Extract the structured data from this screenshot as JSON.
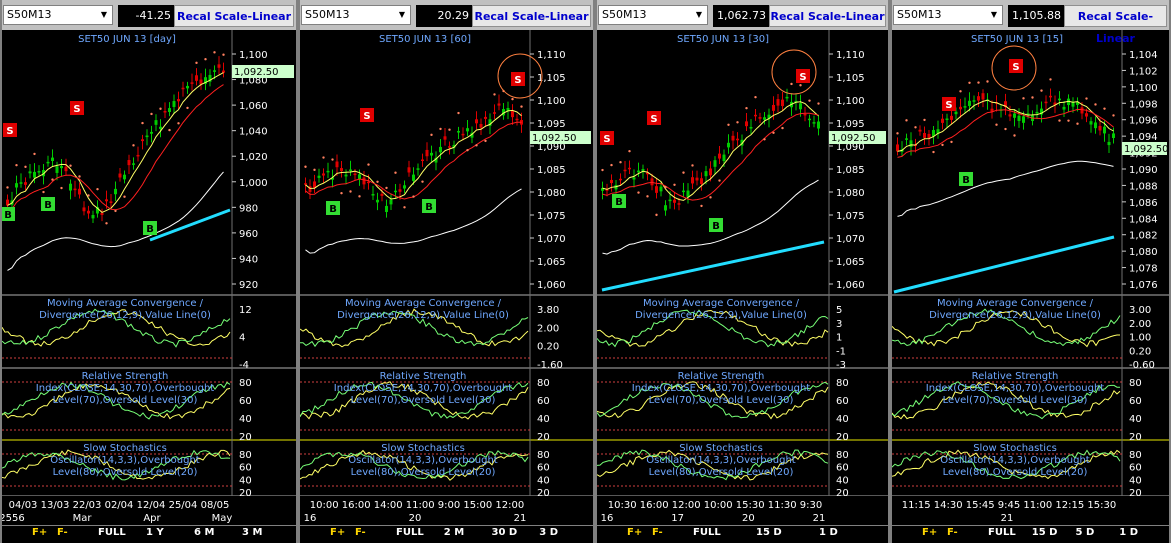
{
  "panels": [
    {
      "symbol": "S50M13",
      "value": "-41.25",
      "recal": "Recal Scale-Linear",
      "title": "SET50 JUN 13   [day]",
      "price_ticks": [
        "1,100",
        "1,080",
        "1,060",
        "1,040",
        "1,020",
        "1,000",
        "980",
        "960",
        "940",
        "920"
      ],
      "last_price": "1,092.50",
      "macd_ticks": [
        "12",
        "4",
        "-4"
      ],
      "rsi_ticks": [
        "80",
        "60",
        "40",
        "20"
      ],
      "stoch_ticks": [
        "80",
        "60",
        "40",
        "20"
      ],
      "time_labels": "04/03 13/03 22/03 02/04 12/04 25/04 08/05",
      "sub_labels": [
        "2556",
        "Mar",
        "Apr",
        "May"
      ],
      "periods": [
        "FULL",
        "1 Y",
        "6 M",
        "3 M"
      ],
      "signals": {
        "s": [
          [
            8,
            130
          ],
          [
            75,
            108
          ],
          [
            235,
            0
          ]
        ],
        "b": [
          [
            6,
            214
          ],
          [
            46,
            204
          ],
          [
            148,
            228
          ]
        ]
      }
    },
    {
      "symbol": "S50M13",
      "value": "20.29",
      "recal": "Recal Scale-Linear",
      "title": "SET50 JUN 13   [60]",
      "price_ticks": [
        "1,110",
        "1,105",
        "1,100",
        "1,095",
        "1,090",
        "1,085",
        "1,080",
        "1,075",
        "1,070",
        "1,065",
        "1,060"
      ],
      "last_price": "1,092.50",
      "macd_ticks": [
        "3.80",
        "2.00",
        "0.20",
        "-1.60"
      ],
      "rsi_ticks": [
        "80",
        "60",
        "40",
        "20"
      ],
      "stoch_ticks": [
        "80",
        "60",
        "40",
        "20"
      ],
      "time_labels": "10:00 16:00 14:00 11:00 9:00   15:00 12:00",
      "sub_labels": [
        "16",
        "20",
        "21"
      ],
      "periods": [
        "FULL",
        "2 M",
        "30 D",
        "3 D"
      ],
      "signals": {
        "s": [
          [
            365,
            115
          ],
          [
            516,
            79
          ]
        ],
        "b": [
          [
            331,
            208
          ],
          [
            427,
            206
          ]
        ]
      }
    },
    {
      "symbol": "S50M13",
      "value": "1,062.73",
      "recal": "Recal Scale-Linear",
      "title": "SET50 JUN 13   [30]",
      "price_ticks": [
        "1,110",
        "1,105",
        "1,100",
        "1,095",
        "1,090",
        "1,085",
        "1,080",
        "1,075",
        "1,070",
        "1,065",
        "1,060"
      ],
      "last_price": "1,092.50",
      "macd_ticks": [
        "5",
        "3",
        "1",
        "-1",
        "-3"
      ],
      "rsi_ticks": [
        "80",
        "60",
        "40",
        "20"
      ],
      "stoch_ticks": [
        "80",
        "60",
        "40",
        "20"
      ],
      "time_labels": "10:30 16:00 12:00 10:00 15:30 11:30 9:30",
      "sub_labels": [
        "16",
        "17",
        "20",
        "21"
      ],
      "periods": [
        "FULL",
        "15 D",
        "1 D"
      ],
      "signals": {
        "s": [
          [
            605,
            138
          ],
          [
            652,
            118
          ],
          [
            801,
            76
          ]
        ],
        "b": [
          [
            617,
            201
          ],
          [
            714,
            225
          ]
        ]
      }
    },
    {
      "symbol": "S50M13",
      "value": "1,105.88",
      "recal": "Recal Scale-Linear",
      "title": "SET50 JUN 13   [15]",
      "price_ticks": [
        "1,104",
        "1,102",
        "1,100",
        "1,098",
        "1,096",
        "1,094",
        "1,092",
        "1,090",
        "1,088",
        "1,086",
        "1,084",
        "1,082",
        "1,080",
        "1,078",
        "1,076"
      ],
      "last_price": "1,092.50",
      "macd_ticks": [
        "3.00",
        "2.00",
        "1.00",
        "0.20",
        "-0.60"
      ],
      "rsi_ticks": [
        "80",
        "60",
        "40",
        "20"
      ],
      "stoch_ticks": [
        "80",
        "60",
        "40",
        "20"
      ],
      "time_labels": "11:15 14:30 15:45 9:45   11:00 12:15 15:30",
      "sub_labels": [
        "21"
      ],
      "periods": [
        "FULL",
        "15 D",
        "5 D",
        "1 D"
      ],
      "signals": {
        "s": [
          [
            947,
            104
          ],
          [
            1014,
            66
          ]
        ],
        "b": [
          [
            964,
            179
          ]
        ]
      }
    }
  ],
  "indicators": {
    "macd": [
      "Moving Average Convergence /",
      "Divergence(26,12,9),Value Line(0)"
    ],
    "rsi": [
      "Relative Strength",
      "Index(CLOSE,14,30,70),Overbought",
      "Level(70),Oversold Level(30)"
    ],
    "stoch": [
      "Slow Stochastics",
      "Oscillator(14,3,3),Overbought",
      "Level(80),Oversold Level(20)"
    ]
  },
  "footer_buttons": [
    "F+",
    "F-"
  ],
  "colors": {
    "up": "#00cc00",
    "down": "#e00000",
    "ma_fast": "#ffff66",
    "ma_mid": "#ff2020",
    "ma_slow": "#ffffff",
    "psar": "#ff8060",
    "trend": "#22ddff",
    "title": "#6fa8ff",
    "last_price_bg": "#ccffcc"
  }
}
